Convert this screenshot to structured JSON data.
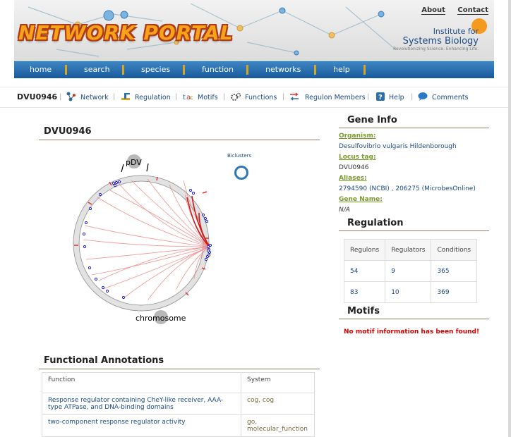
{
  "header": {
    "logo_text": "NETWORK PORTAL",
    "top_links": [
      "About",
      "Contact"
    ],
    "institute_line1": "Institute for",
    "institute_line2": "Systems Biology",
    "institute_tagline": "Revolutionizing Science. Enhancing Life."
  },
  "nav": [
    "home",
    "search",
    "species",
    "function",
    "networks",
    "help"
  ],
  "subnav": {
    "gene": "DVU0946",
    "links": [
      "Network",
      "Regulation",
      "Motifs",
      "Functions",
      "Regulon Members",
      "Help",
      "Comments"
    ]
  },
  "gene_panel": {
    "title": "DVU0946",
    "label_pdv": "pDV",
    "label_chromosome": "chromosome",
    "biclusters_label": "Biclusters"
  },
  "functional_annotations": {
    "title": "Functional Annotations",
    "headers": [
      "Function",
      "System"
    ],
    "rows": [
      {
        "function": "Response regulator containing CheY-like receiver, AAA-type ATPase, and DNA-binding domains",
        "system": "cog, cog"
      },
      {
        "function": "two-component response regulator activity",
        "system": "go, molecular_function"
      }
    ]
  },
  "gene_info": {
    "title": "Gene Info",
    "organism_label": "Organism:",
    "organism": "Desulfovibrio vulgaris Hildenborough",
    "locus_label": "Locus tag:",
    "locus": "DVU0946",
    "aliases_label": "Aliases:",
    "aliases": "2794590 (NCBI) , 206275 (MicrobesOnline)",
    "gene_name_label": "Gene Name:",
    "gene_name": "N/A"
  },
  "regulation": {
    "title": "Regulation",
    "headers": [
      "Regulons",
      "Regulators",
      "Conditions"
    ],
    "rows": [
      [
        "54",
        "9",
        "365"
      ],
      [
        "83",
        "10",
        "369"
      ]
    ]
  },
  "motifs": {
    "title": "Motifs",
    "message": "No motif information has been found!"
  },
  "colors": {
    "nav": "#2a6eaf",
    "accent": "#d9a520",
    "link": "#1c4a86",
    "error": "#d00000",
    "arc": "#e03030"
  }
}
